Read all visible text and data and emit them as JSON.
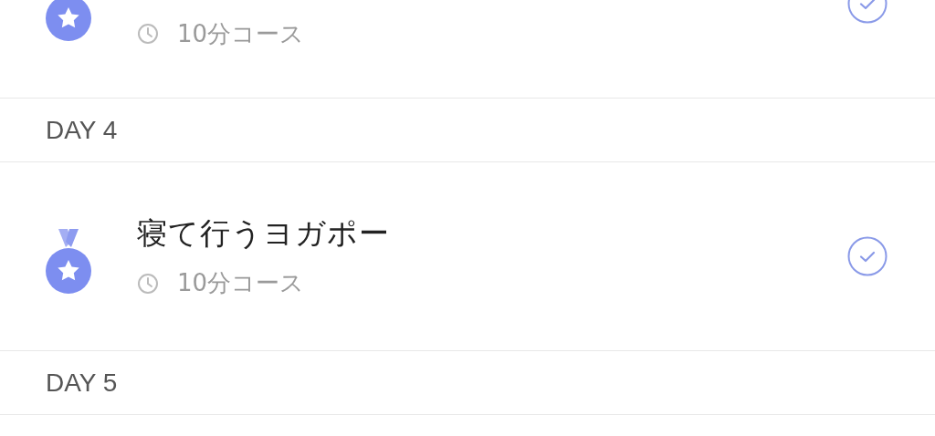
{
  "list": [
    {
      "kind": "lesson",
      "duration": "10分コース",
      "completed": true
    },
    {
      "kind": "header",
      "label": "DAY 4"
    },
    {
      "kind": "lesson",
      "title": "寝て行うヨガポー",
      "duration": "10分コース",
      "completed": true
    },
    {
      "kind": "header",
      "label": "DAY 5"
    }
  ]
}
